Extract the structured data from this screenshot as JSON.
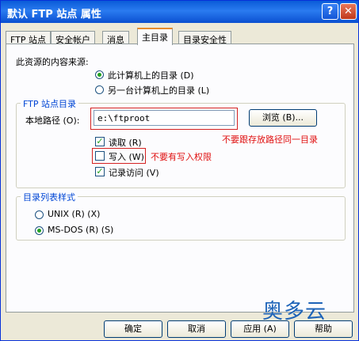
{
  "window": {
    "title": "默认 FTP 站点 属性"
  },
  "titlebar": {
    "help_glyph": "?",
    "close_glyph": "✕"
  },
  "tabs": [
    {
      "label": "FTP 站点"
    },
    {
      "label": "安全帐户"
    },
    {
      "label": "消息"
    },
    {
      "label": "主目录"
    },
    {
      "label": "目录安全性"
    }
  ],
  "content_source": {
    "heading": "此资源的内容来源:",
    "option_local": "此计算机上的目录 (D)",
    "option_remote": "另一台计算机上的目录 (L)",
    "selected": "option_local"
  },
  "ftp_directory": {
    "title": "FTP 站点目录",
    "path_label": "本地路径 (O):",
    "path_value": "e:\\ftproot",
    "browse_button": "浏览 (B)...",
    "read_label": "读取 (R)",
    "read_checked": true,
    "write_label": "写入 (W)",
    "write_checked": false,
    "log_label": "记录访问 (V)",
    "log_checked": true
  },
  "listing_style": {
    "title": "目录列表样式",
    "unix_label": "UNIX (R) (X)",
    "msdos_label": "MS-DOS (R) (S)",
    "selected": "msdos"
  },
  "annotations": {
    "path_note": "不要跟存放路径同一目录",
    "write_note": "不要有写入权限"
  },
  "buttons": {
    "ok": "确定",
    "cancel": "取消",
    "apply": "应用 (A)",
    "help": "帮助"
  },
  "watermark": "奥多云",
  "colors": {
    "accent_title": "#0046d5",
    "annotation_red": "#e01010",
    "check_green": "#21a121"
  }
}
